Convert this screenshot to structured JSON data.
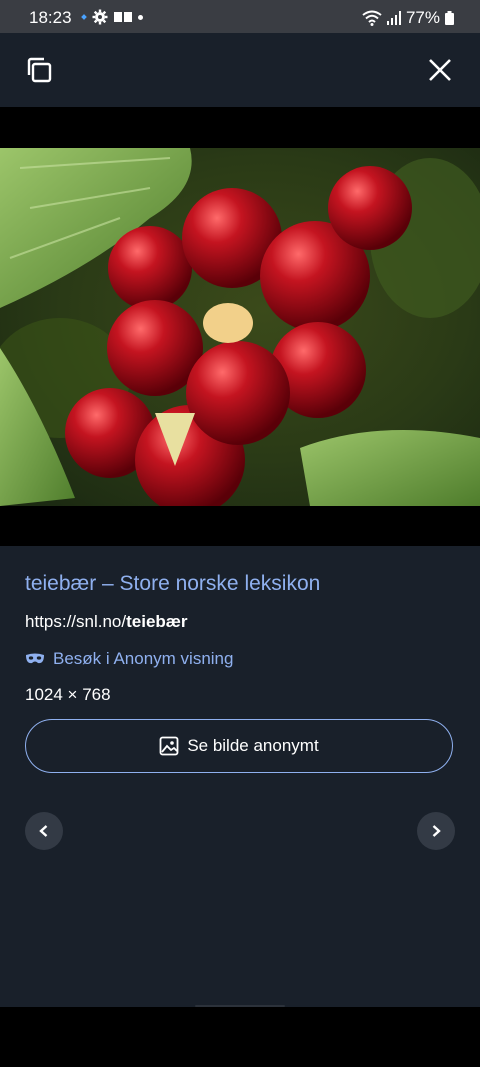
{
  "status": {
    "time": "18:23",
    "battery": "77%"
  },
  "toolbar": {
    "copy_icon": "copy-icon",
    "close_icon": "close-icon"
  },
  "result": {
    "title": "teiebær – Store norske leksikon",
    "url_prefix": "https://snl.no/",
    "url_bold": "teiebær",
    "anon_link": "Besøk i Anonym visning",
    "dimensions": "1024 × 768",
    "button_label": "Se bilde anonymt"
  },
  "colors": {
    "accent": "#8fb0ef",
    "panel_bg": "#19202a",
    "status_bg": "#3a3d43"
  }
}
